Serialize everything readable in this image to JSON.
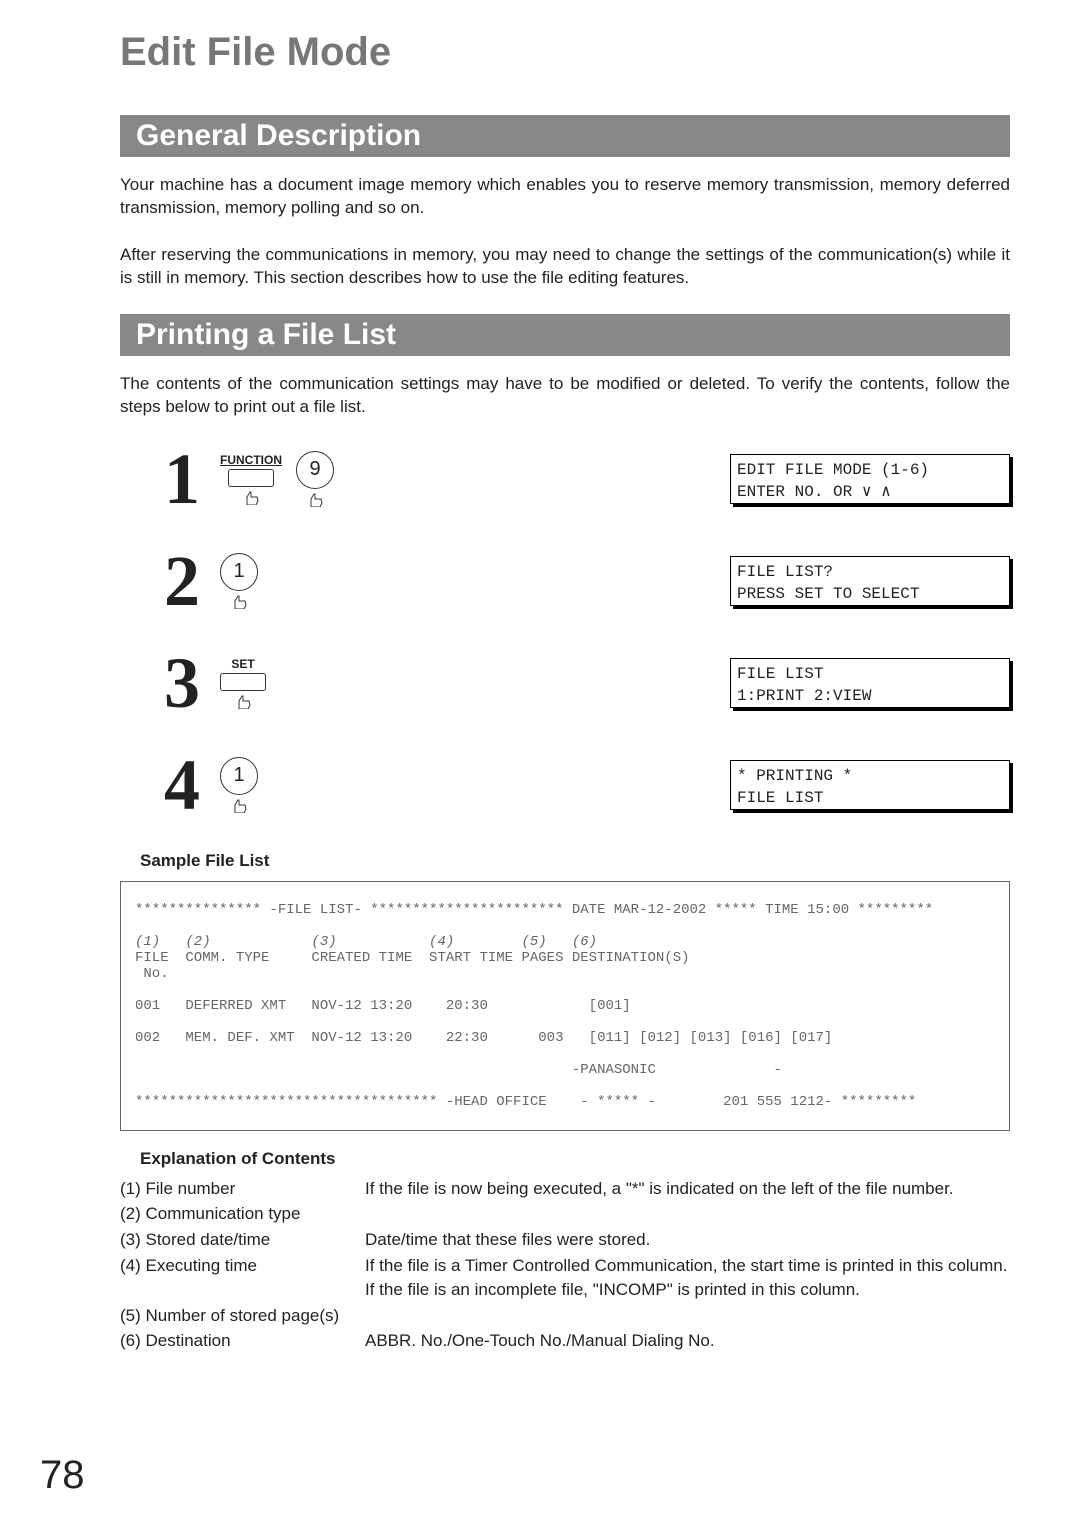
{
  "page_number": "78",
  "title": "Edit File Mode",
  "section1": {
    "heading": "General Description",
    "p1": "Your machine has a document image memory which enables you to reserve memory transmission, memory deferred transmission, memory polling and so on.",
    "p2": "After reserving the communications in memory, you may need to change the settings of the communication(s) while it is still in memory.  This section describes how to use the file editing features."
  },
  "section2": {
    "heading": "Printing a File List",
    "intro": "The contents of the communication settings may have to be modified or deleted.  To verify the contents, follow the steps below to print out a file list."
  },
  "steps": {
    "s1": {
      "num": "1",
      "fn_label": "FUNCTION",
      "key": "9",
      "lcd_l1": "EDIT FILE MODE (1-6)",
      "lcd_l2_prefix": "ENTER NO. OR "
    },
    "s2": {
      "num": "2",
      "key": "1",
      "lcd_l1": "FILE LIST?",
      "lcd_l2": "PRESS SET TO SELECT"
    },
    "s3": {
      "num": "3",
      "set_label": "SET",
      "lcd_l1": "FILE LIST",
      "lcd_l2": "1:PRINT 2:VIEW"
    },
    "s4": {
      "num": "4",
      "key": "1",
      "lcd_l1": "* PRINTING *",
      "lcd_l2": "FILE LIST"
    }
  },
  "sample": {
    "heading": "Sample File List",
    "header_line": "*************** -FILE LIST- *********************** DATE MAR-12-2002 ***** TIME 15:00 *********",
    "col_nums": "(1)   (2)            (3)           (4)        (5)   (6)",
    "col_heads": "FILE  COMM. TYPE     CREATED TIME  START TIME PAGES DESTINATION(S)",
    "col_heads2": " No.",
    "row1": "001   DEFERRED XMT   NOV-12 13:20    20:30            [001]",
    "row2": "002   MEM. DEF. XMT  NOV-12 13:20    22:30      003   [011] [012] [013] [016] [017]",
    "row_pan": "                                                    -PANASONIC              -",
    "footer": "************************************ -HEAD OFFICE    - ***** -        201 555 1212- *********"
  },
  "explanation": {
    "heading": "Explanation of Contents",
    "items": [
      {
        "label": "(1) File number",
        "desc": "If the file is now being executed, a \"*\" is indicated on the left of the file number."
      },
      {
        "label": "(2) Communication type",
        "desc": ""
      },
      {
        "label": "(3) Stored date/time",
        "desc": "Date/time that these files were stored."
      },
      {
        "label": "(4) Executing time",
        "desc": "If the file is a Timer Controlled Communication, the start time is printed in this column.\nIf the file is an incomplete file, \"INCOMP\" is printed in this column."
      },
      {
        "label": "(5) Number of stored page(s)",
        "desc": ""
      },
      {
        "label": "(6) Destination",
        "desc": "ABBR. No./One-Touch No./Manual Dialing No."
      }
    ]
  }
}
